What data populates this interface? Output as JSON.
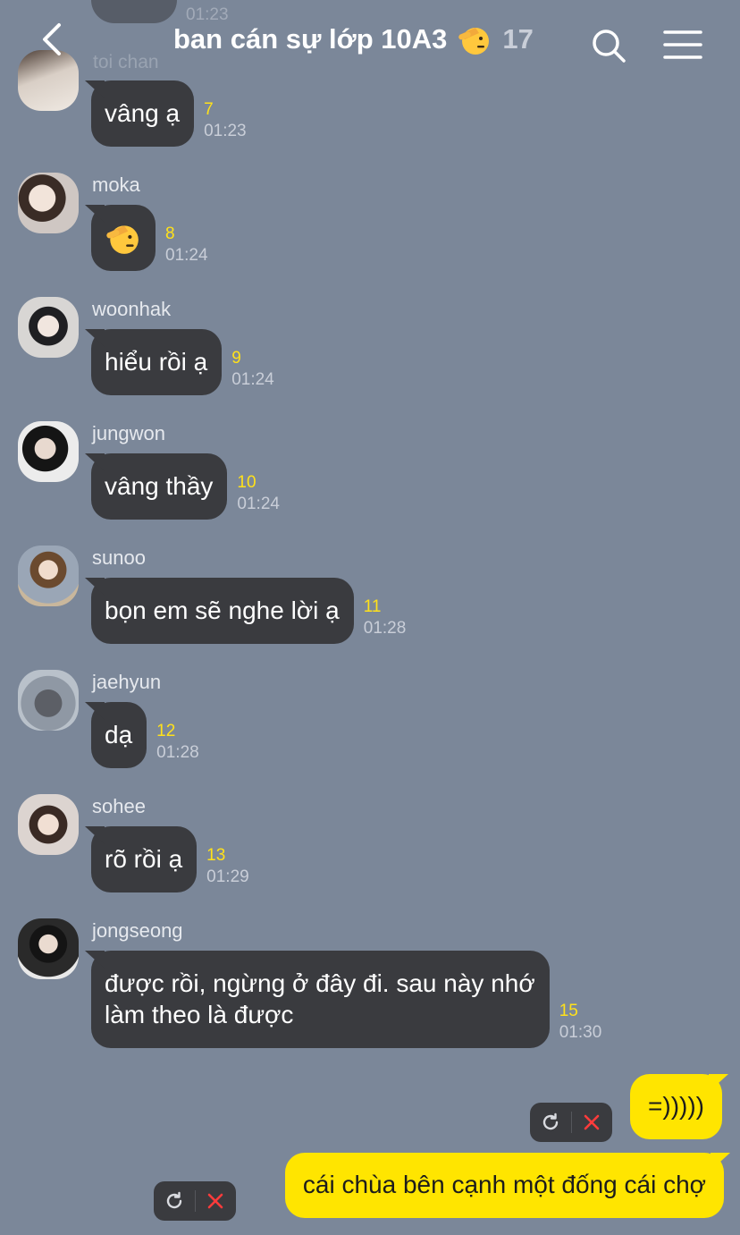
{
  "header": {
    "title": "ban cán sự lớp 10A3",
    "member_count": "17"
  },
  "ghost": {
    "name": "toi chan",
    "time": "01:23"
  },
  "messages": [
    {
      "sender": "",
      "text": "vâng ạ",
      "unread": "7",
      "time": "01:23",
      "emoji": false
    },
    {
      "sender": "moka",
      "text": "",
      "unread": "8",
      "time": "01:24",
      "emoji": true
    },
    {
      "sender": "woonhak",
      "text": "hiểu rồi ạ",
      "unread": "9",
      "time": "01:24",
      "emoji": false
    },
    {
      "sender": "jungwon",
      "text": "vâng thầy",
      "unread": "10",
      "time": "01:24",
      "emoji": false
    },
    {
      "sender": "sunoo",
      "text": "bọn em sẽ nghe lời ạ",
      "unread": "11",
      "time": "01:28",
      "emoji": false
    },
    {
      "sender": "jaehyun",
      "text": "dạ",
      "unread": "12",
      "time": "01:28",
      "emoji": false
    },
    {
      "sender": "sohee",
      "text": "rõ rồi ạ",
      "unread": "13",
      "time": "01:29",
      "emoji": false
    },
    {
      "sender": "jongseong",
      "text_line1": "được rồi, ngừng ở đây đi. sau này nhớ",
      "text_line2": "làm theo là được",
      "unread": "15",
      "time": "01:30",
      "emoji": false
    }
  ],
  "outgoing": [
    {
      "text": "=)))))",
      "status": "failed"
    },
    {
      "text": "cái chùa bên cạnh một đống cái chợ",
      "status": "failed"
    }
  ],
  "icons": {
    "back": "chevron-left-icon",
    "search": "search-icon",
    "menu": "hamburger-menu-icon",
    "salute": "saluting-face-icon",
    "retry": "retry-icon",
    "cancel": "close-icon"
  },
  "colors": {
    "background": "#7b8799",
    "incoming_bubble": "#3a3b3f",
    "outgoing_bubble": "#ffe500",
    "unread_count": "#ffe11a"
  }
}
